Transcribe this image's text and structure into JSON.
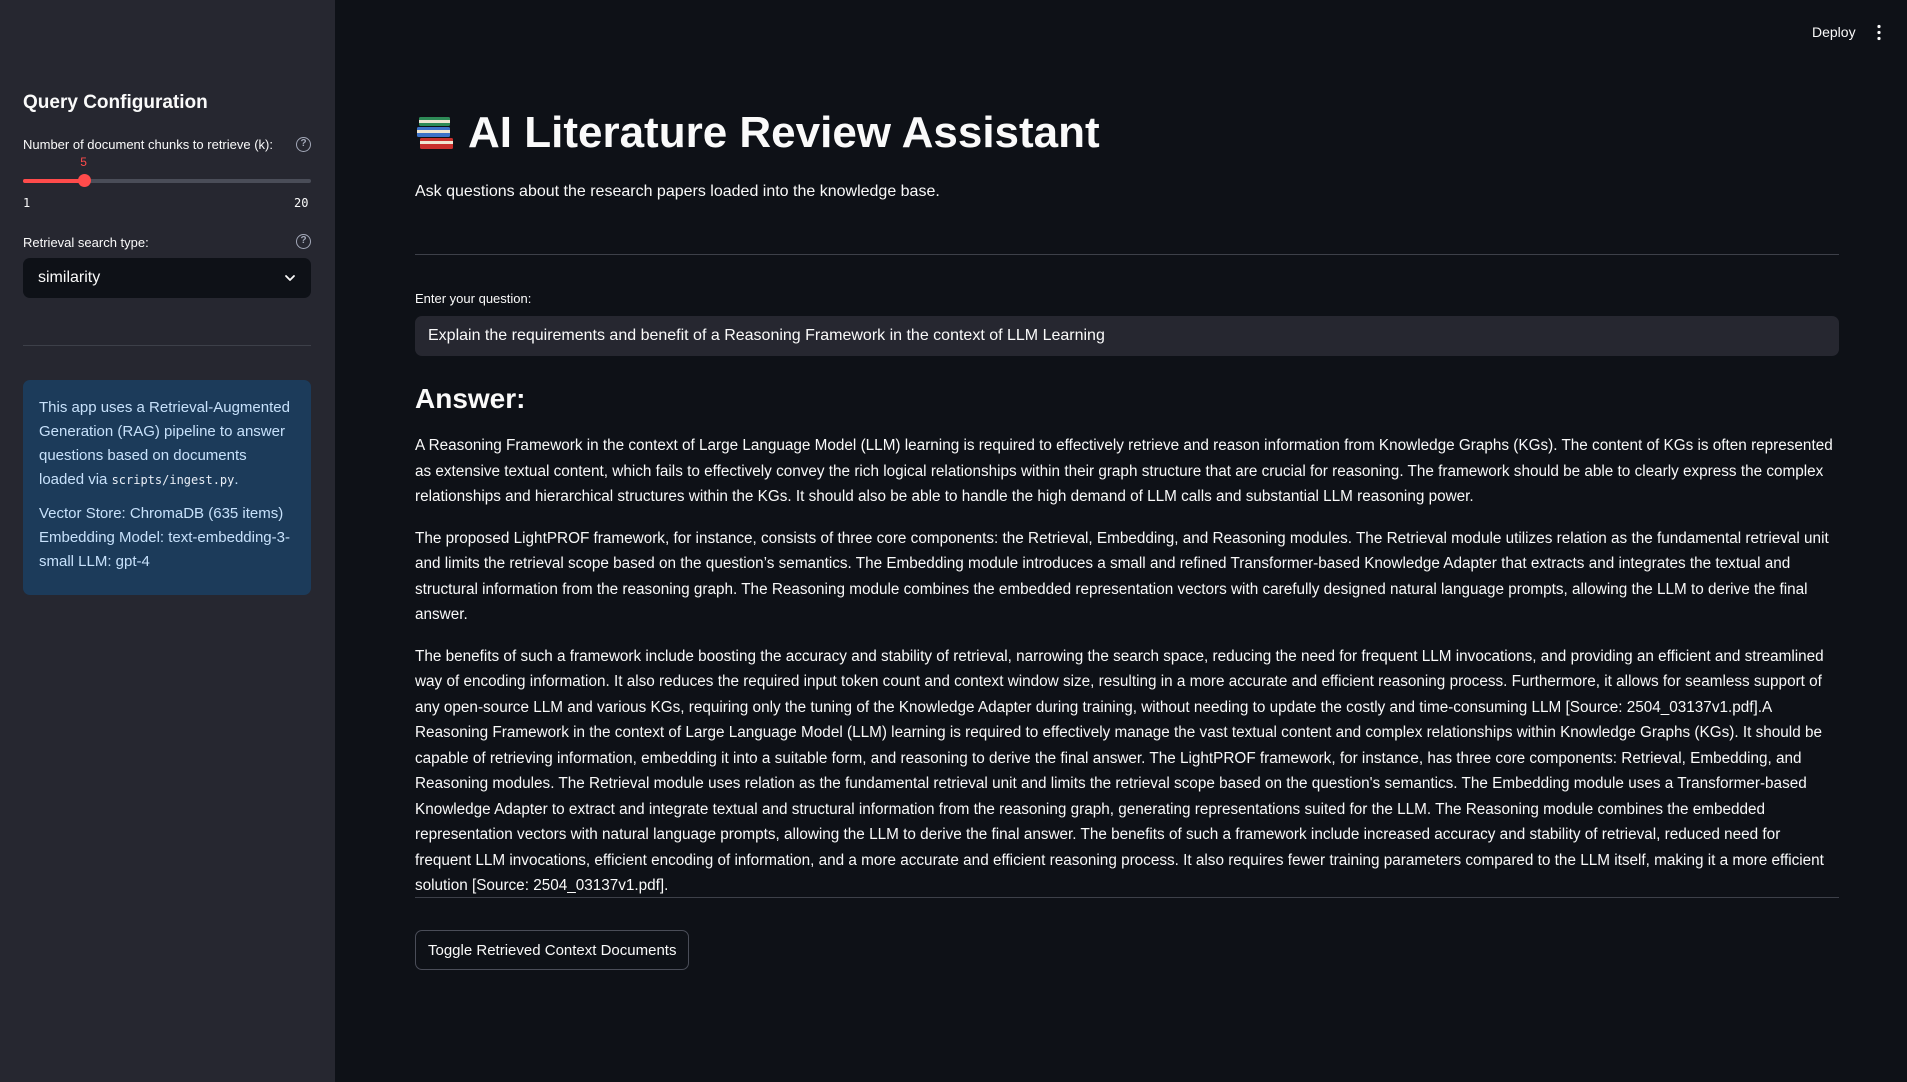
{
  "topbar": {
    "deploy_label": "Deploy",
    "menu_icon": "vertical-ellipsis-icon"
  },
  "sidebar": {
    "title": "Query Configuration",
    "k_slider": {
      "label": "Number of document chunks to retrieve (k):",
      "min": 1,
      "max": 20,
      "value": 5,
      "min_label": "1",
      "max_label": "20",
      "value_label": "5",
      "accent_color": "#ff4b4b"
    },
    "search_type": {
      "label": "Retrieval search type:",
      "selected": "similarity"
    },
    "info": {
      "text_before_code": "This app uses a Retrieval-Augmented Generation (RAG) pipeline to answer questions based on documents loaded via ",
      "code": "scripts/ingest.py",
      "text_after_code": ".",
      "details": "Vector Store: ChromaDB (635 items) Embedding Model: text-embedding-3-small LLM: gpt-4"
    }
  },
  "main": {
    "title_icon": "books-icon",
    "title": "AI Literature Review Assistant",
    "subtitle": "Ask questions about the research papers loaded into the knowledge base.",
    "question_label": "Enter your question:",
    "question_value": "Explain the requirements and benefit of a Reasoning Framework in the context of LLM Learning",
    "answer_heading": "Answer:",
    "answer_paragraphs": [
      "A Reasoning Framework in the context of Large Language Model (LLM) learning is required to effectively retrieve and reason information from Knowledge Graphs (KGs). The content of KGs is often represented as extensive textual content, which fails to effectively convey the rich logical relationships within their graph structure that are crucial for reasoning. The framework should be able to clearly express the complex relationships and hierarchical structures within the KGs. It should also be able to handle the high demand of LLM calls and substantial LLM reasoning power.",
      "The proposed LightPROF framework, for instance, consists of three core components: the Retrieval, Embedding, and Reasoning modules. The Retrieval module utilizes relation as the fundamental retrieval unit and limits the retrieval scope based on the question’s semantics. The Embedding module introduces a small and refined Transformer-based Knowledge Adapter that extracts and integrates the textual and structural information from the reasoning graph. The Reasoning module combines the embedded representation vectors with carefully designed natural language prompts, allowing the LLM to derive the final answer.",
      "The benefits of such a framework include boosting the accuracy and stability of retrieval, narrowing the search space, reducing the need for frequent LLM invocations, and providing an efficient and streamlined way of encoding information. It also reduces the required input token count and context window size, resulting in a more accurate and efficient reasoning process. Furthermore, it allows for seamless support of any open-source LLM and various KGs, requiring only the tuning of the Knowledge Adapter during training, without needing to update the costly and time-consuming LLM [Source: 2504_03137v1.pdf].A Reasoning Framework in the context of Large Language Model (LLM) learning is required to effectively manage the vast textual content and complex relationships within Knowledge Graphs (KGs). It should be capable of retrieving information, embedding it into a suitable form, and reasoning to derive the final answer. The LightPROF framework, for instance, has three core components: Retrieval, Embedding, and Reasoning modules. The Retrieval module uses relation as the fundamental retrieval unit and limits the retrieval scope based on the question's semantics. The Embedding module uses a Transformer-based Knowledge Adapter to extract and integrate textual and structural information from the reasoning graph, generating representations suited for the LLM. The Reasoning module combines the embedded representation vectors with natural language prompts, allowing the LLM to derive the final answer. The benefits of such a framework include increased accuracy and stability of retrieval, reduced need for frequent LLM invocations, efficient encoding of information, and a more accurate and efficient reasoning process. It also requires fewer training parameters compared to the LLM itself, making it a more efficient solution [Source: 2504_03137v1.pdf]."
    ],
    "toggle_button_label": "Toggle Retrieved Context Documents"
  },
  "colors": {
    "background": "#0e1117",
    "sidebar": "#262730",
    "info_box": "#1c3b5a",
    "info_text": "#c7e1fb",
    "accent": "#ff4b4b"
  }
}
